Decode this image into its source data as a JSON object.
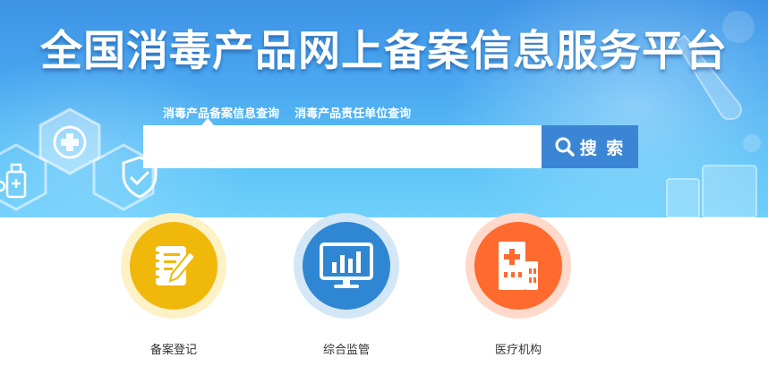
{
  "header": {
    "title": "全国消毒产品网上备案信息服务平台"
  },
  "search": {
    "tabs": [
      {
        "label": "消毒产品备案信息查询",
        "active": true
      },
      {
        "label": "消毒产品责任单位查询",
        "active": false
      }
    ],
    "input_value": "",
    "button_label": "搜 索",
    "button_icon": "search-icon"
  },
  "services": [
    {
      "label": "备案登记",
      "icon": "notepad-pen-icon",
      "color": "#f0b80a",
      "ring": "#fdf1c6"
    },
    {
      "label": "综合监管",
      "icon": "monitor-chart-icon",
      "color": "#2f86d2",
      "ring": "#d3e7f7"
    },
    {
      "label": "医疗机构",
      "icon": "hospital-icon",
      "color": "#ff6a2f",
      "ring": "#ffd9c9"
    }
  ],
  "colors": {
    "banner_top": "#3f93e6",
    "banner_bottom": "#6fd0fb",
    "search_button": "#3b86d4"
  }
}
